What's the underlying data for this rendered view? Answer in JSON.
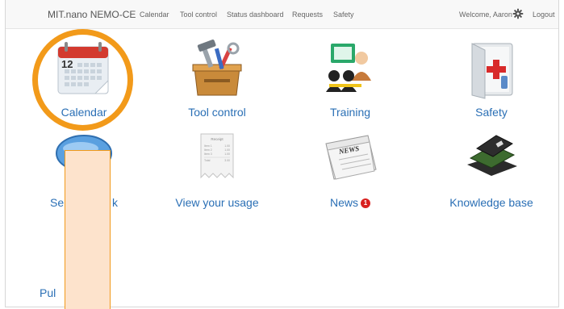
{
  "navbar": {
    "brand": "MIT.nano NEMO-CE",
    "links": [
      "Calendar",
      "Tool control",
      "Status dashboard",
      "Requests",
      "Safety"
    ],
    "welcome": "Welcome, Aaron",
    "logout": "Logout",
    "settings_icon": "gear-icon"
  },
  "tiles": [
    {
      "label": "Calendar",
      "icon": "calendar-icon"
    },
    {
      "label": "Tool control",
      "icon": "toolbox-icon"
    },
    {
      "label": "Training",
      "icon": "training-icon"
    },
    {
      "label": "Safety",
      "icon": "first-aid-icon"
    },
    {
      "label": "Send feedback",
      "visible_label": "Sen",
      "visible_label_tail": "k",
      "icon": "feedback-icon"
    },
    {
      "label": "View your usage",
      "icon": "receipt-icon"
    },
    {
      "label": "News",
      "badge": "1",
      "icon": "newspaper-icon"
    },
    {
      "label": "Knowledge base",
      "icon": "books-icon"
    },
    {
      "visible_label": "Pul",
      "icon": "phone-icon"
    }
  ],
  "receipt": {
    "title": "Receipt",
    "lines": [
      [
        "Item 1",
        "1.00"
      ],
      [
        "Item 2",
        "1.00"
      ],
      [
        "Item 3",
        "1.00"
      ]
    ],
    "total_label": "Total",
    "total_value": "3.00"
  },
  "calendar_day": "12",
  "colors": {
    "link": "#2a6fb5",
    "highlight": "#f29a1a",
    "redaction_fill": "#fde3cc",
    "badge": "#d9201f"
  }
}
